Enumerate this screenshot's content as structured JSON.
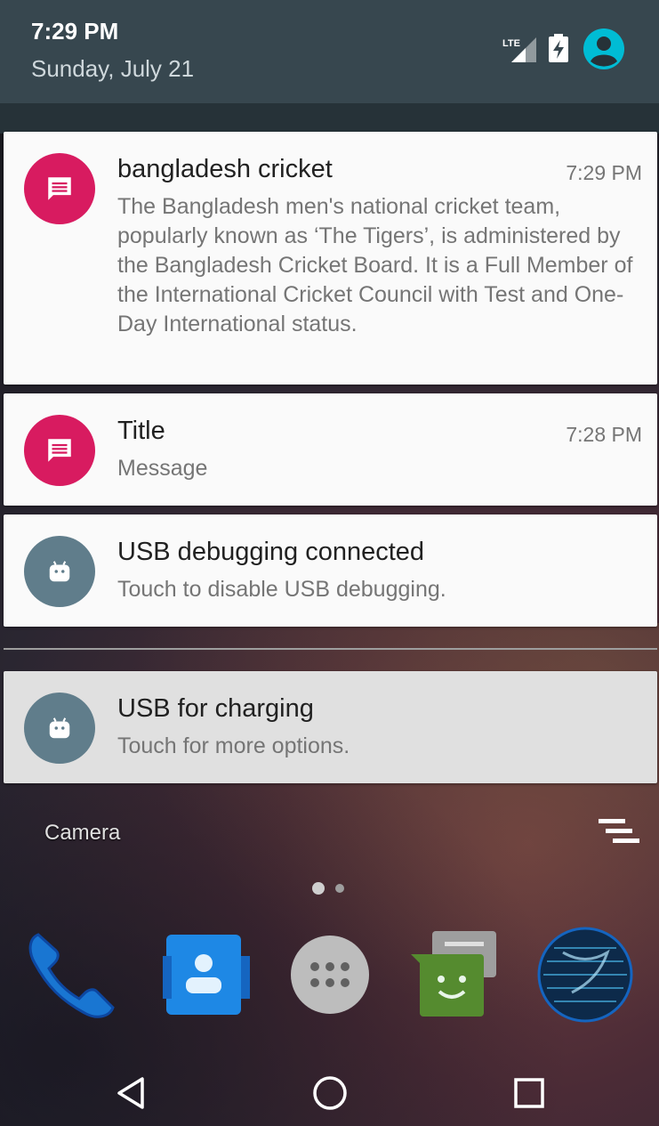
{
  "status_bar": {
    "time": "7:29 PM",
    "date": "Sunday, July 21",
    "network_label": "LTE",
    "icons": [
      "lte-signal-icon",
      "battery-charging-icon",
      "user-avatar-icon"
    ]
  },
  "notifications": [
    {
      "app_icon": "chat-icon",
      "icon_color": "#d81b60",
      "title": "bangladesh cricket",
      "time": "7:29 PM",
      "body": "The Bangladesh men's national cricket team, popularly known as ‘The Tigers’, is administered by the Bangladesh Cricket Board. It is a Full Member of the International Cricket Council with Test and One-Day International status."
    },
    {
      "app_icon": "chat-icon",
      "icon_color": "#d81b60",
      "title": "Title",
      "time": "7:28 PM",
      "body": "Message"
    },
    {
      "app_icon": "android-icon",
      "icon_color": "#607d8b",
      "title": "USB debugging connected",
      "body": "Touch to disable USB debugging."
    },
    {
      "app_icon": "android-icon",
      "icon_color": "#607d8b",
      "title": "USB for charging",
      "body": "Touch for more options."
    }
  ],
  "home": {
    "camera_label": "Camera",
    "dock": [
      "phone-icon",
      "contacts-icon",
      "app-drawer-icon",
      "messenger-icon",
      "browser-globe-icon"
    ]
  },
  "navigation": [
    "back-icon",
    "home-icon",
    "recents-icon"
  ]
}
